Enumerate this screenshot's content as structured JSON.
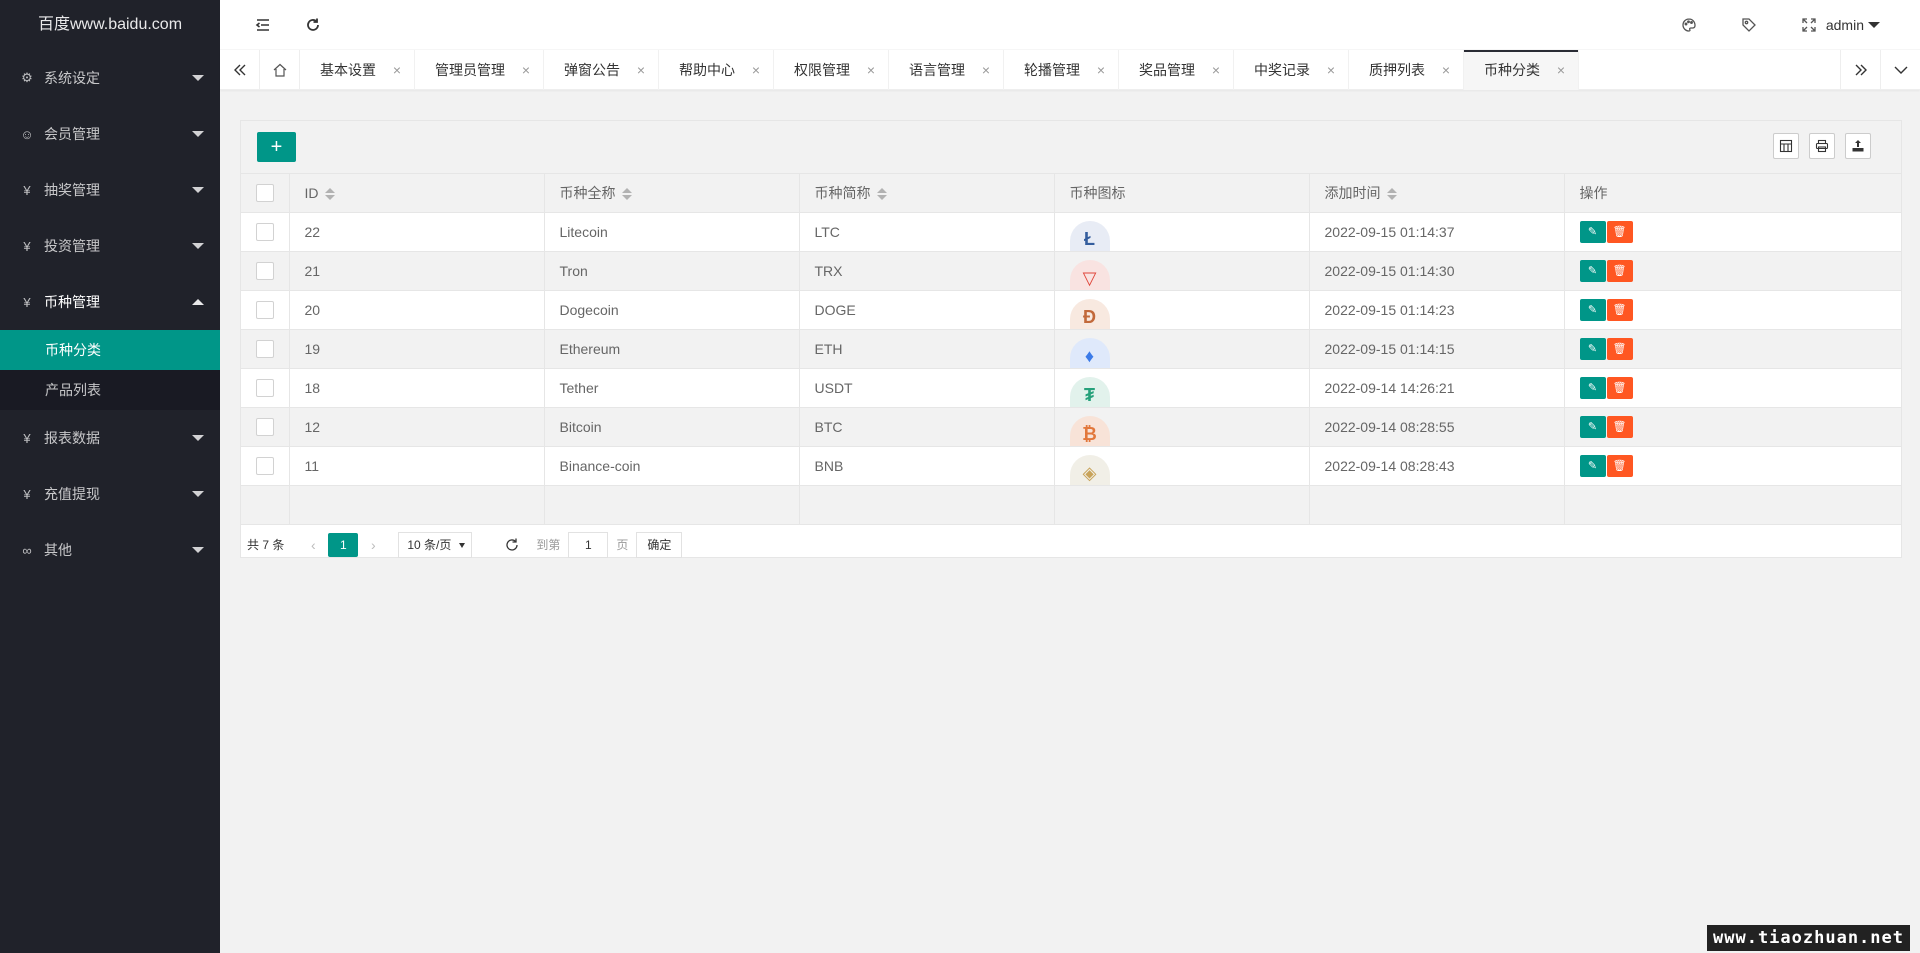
{
  "brand": "百度www.baidu.com",
  "sidebar": {
    "items": [
      {
        "label": "系统设定",
        "icon": "gear-icon"
      },
      {
        "label": "会员管理",
        "icon": "user-icon"
      },
      {
        "label": "抽奖管理",
        "icon": "yen-icon"
      },
      {
        "label": "投资管理",
        "icon": "yen-icon"
      },
      {
        "label": "币种管理",
        "icon": "yen-icon",
        "open": true,
        "sub": [
          {
            "label": "币种分类",
            "active": true
          },
          {
            "label": "产品列表"
          }
        ]
      },
      {
        "label": "报表数据",
        "icon": "yen-icon"
      },
      {
        "label": "充值提现",
        "icon": "yen-icon"
      },
      {
        "label": "其他",
        "icon": "link-icon"
      }
    ]
  },
  "header": {
    "user": "admin"
  },
  "tabs": [
    "基本设置",
    "管理员管理",
    "弹窗公告",
    "帮助中心",
    "权限管理",
    "语言管理",
    "轮播管理",
    "奖品管理",
    "中奖记录",
    "质押列表",
    "币种分类"
  ],
  "active_tab": "币种分类",
  "table": {
    "columns": [
      "ID",
      "币种全称",
      "币种简称",
      "币种图标",
      "添加时间",
      "操作"
    ],
    "rows": [
      {
        "id": "22",
        "name": "Litecoin",
        "symbol": "LTC",
        "time": "2022-09-15 01:14:37",
        "glyph": "Ł",
        "color": "#345d9d",
        "bg": "#e8ecf5"
      },
      {
        "id": "21",
        "name": "Tron",
        "symbol": "TRX",
        "time": "2022-09-15 01:14:30",
        "glyph": "▽",
        "color": "#e0463a",
        "bg": "#f9e3e1"
      },
      {
        "id": "20",
        "name": "Dogecoin",
        "symbol": "DOGE",
        "time": "2022-09-15 01:14:23",
        "glyph": "Ð",
        "color": "#c2693b",
        "bg": "#f8e9e0"
      },
      {
        "id": "19",
        "name": "Ethereum",
        "symbol": "ETH",
        "time": "2022-09-15 01:14:15",
        "glyph": "♦",
        "color": "#3c7be8",
        "bg": "#dfe9fb"
      },
      {
        "id": "18",
        "name": "Tether",
        "symbol": "USDT",
        "time": "2022-09-14 14:26:21",
        "glyph": "₮",
        "color": "#26a17b",
        "bg": "#e2f2ec"
      },
      {
        "id": "12",
        "name": "Bitcoin",
        "symbol": "BTC",
        "time": "2022-09-14 08:28:55",
        "glyph": "₿",
        "color": "#e2773b",
        "bg": "#f8e3d8"
      },
      {
        "id": "11",
        "name": "Binance-coin",
        "symbol": "BNB",
        "time": "2022-09-14 08:28:43",
        "glyph": "◈",
        "color": "#c8a35a",
        "bg": "#f1efe7"
      }
    ]
  },
  "pager": {
    "total": "共 7 条",
    "current": "1",
    "limit": "10 条/页",
    "goto_label": "到第",
    "page_value": "1",
    "page_label": "页",
    "confirm": "确定"
  },
  "watermark": "www.tiaozhuan.net"
}
